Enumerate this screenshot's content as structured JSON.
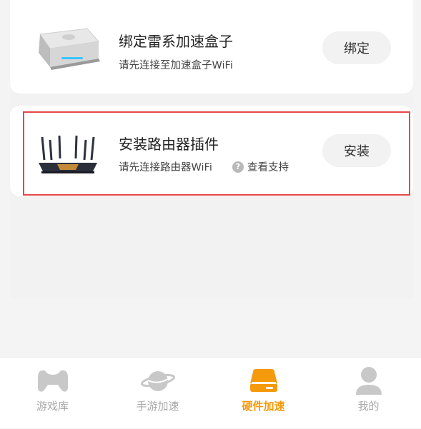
{
  "cards": [
    {
      "title": "绑定雷系加速盒子",
      "subtitle": "请先连接至加速盒子WiFi",
      "button": "绑定"
    },
    {
      "title": "安装路由器插件",
      "subtitle": "请先连接路由器WiFi",
      "help_link": "查看支持",
      "help_icon_glyph": "?",
      "button": "安装"
    }
  ],
  "tabbar": {
    "active": 2,
    "active_color": "#f59a0c",
    "inactive_color": "#a8a8a8",
    "items": [
      {
        "label": "游戏库",
        "icon": "gamepad-icon"
      },
      {
        "label": "手游加速",
        "icon": "planet-icon"
      },
      {
        "label": "硬件加速",
        "icon": "hardware-box-icon"
      },
      {
        "label": "我的",
        "icon": "user-icon"
      }
    ]
  }
}
